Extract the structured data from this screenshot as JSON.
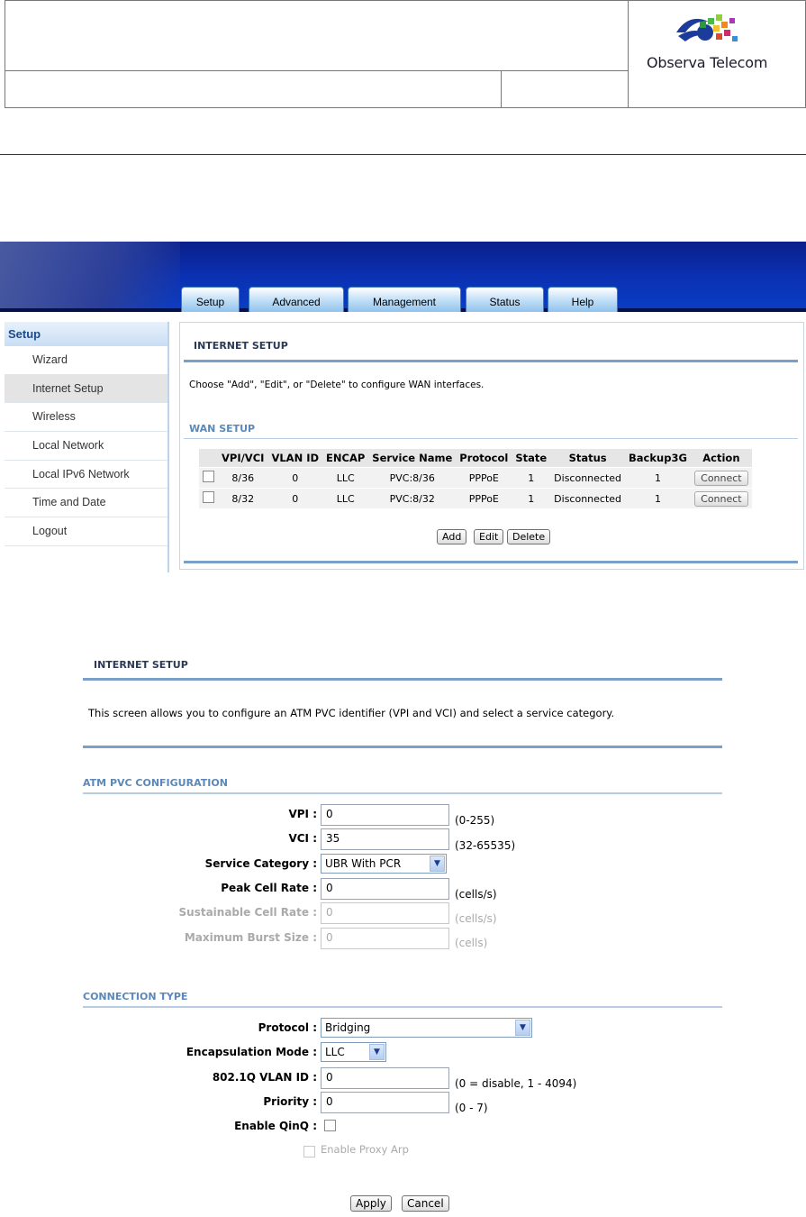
{
  "document": {
    "logo_text": "Observa Telecom"
  },
  "router": {
    "tabs": [
      "Setup",
      "Advanced",
      "Management",
      "Status",
      "Help"
    ],
    "sidebar": {
      "heading": "Setup",
      "items": [
        "Wizard",
        "Internet Setup",
        "Wireless",
        "Local Network",
        "Local IPv6 Network",
        "Time and Date",
        "Logout"
      ],
      "active": "Internet Setup"
    },
    "internet_setup_title": "INTERNET SETUP",
    "intro": "Choose \"Add\", \"Edit\", or \"Delete\" to configure WAN interfaces.",
    "wan_title": "WAN SETUP",
    "table": {
      "headers": [
        "",
        "VPI/VCI",
        "VLAN ID",
        "ENCAP",
        "Service Name",
        "Protocol",
        "State",
        "Status",
        "Backup3G",
        "Action"
      ],
      "rows": [
        {
          "vpi_vci": "8/36",
          "vlan_id": "0",
          "encap": "LLC",
          "service": "PVC:8/36",
          "protocol": "PPPoE",
          "state": "1",
          "status": "Disconnected",
          "backup": "1",
          "action": "Connect"
        },
        {
          "vpi_vci": "8/32",
          "vlan_id": "0",
          "encap": "LLC",
          "service": "PVC:8/32",
          "protocol": "PPPoE",
          "state": "1",
          "status": "Disconnected",
          "backup": "1",
          "action": "Connect"
        }
      ]
    },
    "buttons": {
      "add": "Add",
      "edit": "Edit",
      "delete": "Delete"
    }
  },
  "atm": {
    "title": "INTERNET SETUP",
    "intro": "This screen allows you to configure an ATM PVC identifier (VPI and VCI) and select a service category.",
    "pvc_title": "ATM PVC CONFIGURATION",
    "vpi": {
      "label": "VPI :",
      "value": "0",
      "hint": "(0-255)"
    },
    "vci": {
      "label": "VCI :",
      "value": "35",
      "hint": "(32-65535)"
    },
    "service_category": {
      "label": "Service Category :",
      "value": "UBR With PCR"
    },
    "peak_cell_rate": {
      "label": "Peak Cell Rate :",
      "value": "0",
      "hint": "(cells/s)"
    },
    "sustainable_cell_rate": {
      "label": "Sustainable Cell Rate :",
      "value": "0",
      "hint": "(cells/s)"
    },
    "max_burst_size": {
      "label": "Maximum Burst Size :",
      "value": "0",
      "hint": "(cells)"
    },
    "conn_title": "CONNECTION TYPE",
    "protocol": {
      "label": "Protocol :",
      "value": "Bridging"
    },
    "encapsulation": {
      "label": "Encapsulation Mode :",
      "value": "LLC"
    },
    "vlan_id": {
      "label": "802.1Q VLAN ID :",
      "value": "0",
      "hint": "(0 = disable, 1 - 4094)"
    },
    "priority": {
      "label": "Priority :",
      "value": "0",
      "hint": "(0 - 7)"
    },
    "qinq": {
      "label": "Enable QinQ :"
    },
    "proxy_arp": {
      "label": "Enable Proxy Arp"
    },
    "apply": "Apply",
    "cancel": "Cancel"
  }
}
